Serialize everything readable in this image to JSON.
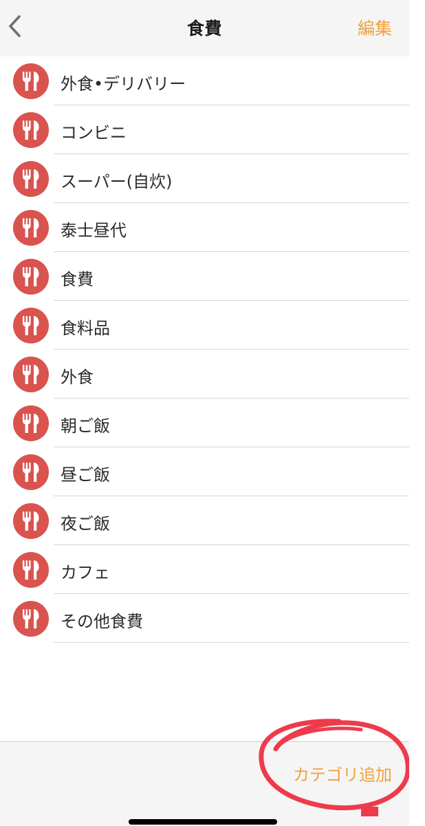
{
  "navbar": {
    "title": "食費",
    "edit_label": "編集"
  },
  "categories": [
    {
      "label": "外食•デリバリー"
    },
    {
      "label": "コンビニ"
    },
    {
      "label": "スーパー(自炊)"
    },
    {
      "label": "泰士昼代"
    },
    {
      "label": "食費"
    },
    {
      "label": "食料品"
    },
    {
      "label": "外食"
    },
    {
      "label": "朝ご飯"
    },
    {
      "label": "昼ご飯"
    },
    {
      "label": "夜ご飯"
    },
    {
      "label": "カフェ"
    },
    {
      "label": "その他食費"
    }
  ],
  "bottom_bar": {
    "add_category_label": "カテゴリ追加"
  },
  "icons": {
    "back": "chevron-left-icon",
    "category": "fork-knife-icon"
  },
  "colors": {
    "accent": "#f0a23a",
    "category_icon_bg": "#d9534f",
    "annotation": "#ee3b4c"
  }
}
